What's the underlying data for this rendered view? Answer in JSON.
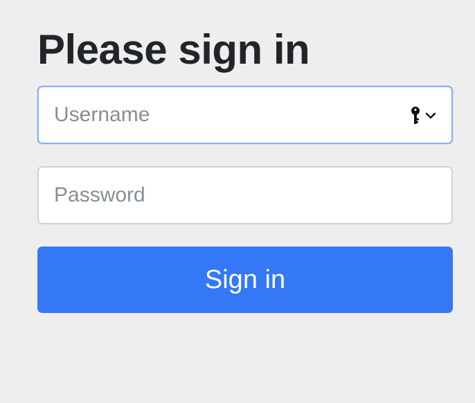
{
  "heading": "Please sign in",
  "username": {
    "placeholder": "Username",
    "value": ""
  },
  "password": {
    "placeholder": "Password",
    "value": ""
  },
  "submit_label": "Sign in",
  "icons": {
    "autofill": "key-icon",
    "dropdown": "chevron-down-icon"
  },
  "colors": {
    "background": "#eeeeee",
    "heading": "#212529",
    "primary_button": "#3578f6",
    "focused_border": "#86b1f2",
    "input_border": "#cfd2d6",
    "placeholder": "#868e96"
  }
}
